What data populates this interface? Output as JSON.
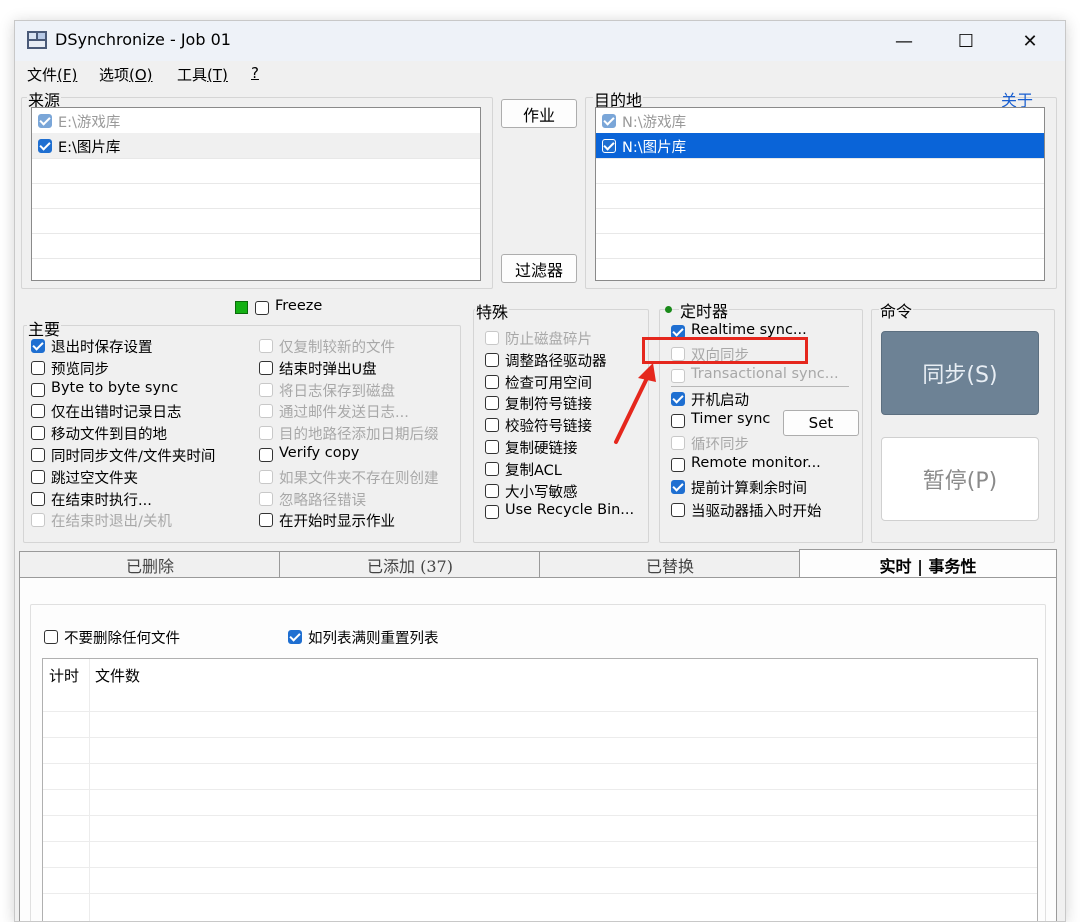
{
  "window": {
    "title": "DSynchronize - Job 01",
    "minimize": "—",
    "maximize": "☐",
    "close": "✕"
  },
  "menu": [
    {
      "label": "文件",
      "key": "(F)"
    },
    {
      "label": "选项",
      "key": "(O)"
    },
    {
      "label": "工具",
      "key": "(T)"
    },
    {
      "label": "",
      "key": "?"
    }
  ],
  "source": {
    "label": "来源",
    "items": [
      {
        "path": "E:\\游戏库",
        "checked": true
      },
      {
        "path": "E:\\图片库",
        "checked": true
      }
    ]
  },
  "destination": {
    "label": "目的地",
    "about_link": "关于",
    "items": [
      {
        "path": "N:\\游戏库",
        "checked": true
      },
      {
        "path": "N:\\图片库",
        "checked": true,
        "selected": true
      }
    ]
  },
  "buttons": {
    "job": "作业",
    "filter": "过滤器",
    "set": "Set",
    "sync": "同步(S)",
    "pause": "暂停(P)"
  },
  "main": {
    "label": "主要",
    "freeze": "Freeze",
    "col1": [
      {
        "label": "退出时保存设置",
        "checked": true,
        "enabled": true
      },
      {
        "label": "预览同步",
        "checked": false,
        "enabled": true
      },
      {
        "label": "Byte to byte sync",
        "checked": false,
        "enabled": true
      },
      {
        "label": "仅在出错时记录日志",
        "checked": false,
        "enabled": true
      },
      {
        "label": "移动文件到目的地",
        "checked": false,
        "enabled": true
      },
      {
        "label": "同时同步文件/文件夹时间",
        "checked": false,
        "enabled": true
      },
      {
        "label": "跳过空文件夹",
        "checked": false,
        "enabled": true
      },
      {
        "label": "在结束时执行...",
        "checked": false,
        "enabled": true
      },
      {
        "label": "在结束时退出/关机",
        "checked": false,
        "enabled": false
      }
    ],
    "col2": [
      {
        "label": "仅复制较新的文件",
        "checked": false,
        "enabled": false
      },
      {
        "label": "结束时弹出U盘",
        "checked": false,
        "enabled": true
      },
      {
        "label": "将日志保存到磁盘",
        "checked": false,
        "enabled": false
      },
      {
        "label": "通过邮件发送日志...",
        "checked": false,
        "enabled": false
      },
      {
        "label": "目的地路径添加日期后缀",
        "checked": false,
        "enabled": false
      },
      {
        "label": "Verify copy",
        "checked": false,
        "enabled": true
      },
      {
        "label": "如果文件夹不存在则创建",
        "checked": false,
        "enabled": false
      },
      {
        "label": "忽略路径错误",
        "checked": false,
        "enabled": false
      },
      {
        "label": "在开始时显示作业",
        "checked": false,
        "enabled": true
      }
    ]
  },
  "special": {
    "label": "特殊",
    "items": [
      {
        "label": "防止磁盘碎片",
        "checked": false,
        "enabled": false
      },
      {
        "label": "调整路径驱动器",
        "checked": false,
        "enabled": true
      },
      {
        "label": "检查可用空间",
        "checked": false,
        "enabled": true
      },
      {
        "label": "复制符号链接",
        "checked": false,
        "enabled": true
      },
      {
        "label": "校验符号链接",
        "checked": false,
        "enabled": true
      },
      {
        "label": "复制硬链接",
        "checked": false,
        "enabled": true
      },
      {
        "label": "复制ACL",
        "checked": false,
        "enabled": true
      },
      {
        "label": "大小写敏感",
        "checked": false,
        "enabled": true
      },
      {
        "label": "Use Recycle Bin...",
        "checked": false,
        "enabled": true
      }
    ]
  },
  "timer": {
    "label": "定时器",
    "indicator_color": "#1a8a1a",
    "items": [
      {
        "label": "Realtime sync...",
        "checked": true,
        "enabled": true
      },
      {
        "label": "双向同步",
        "checked": false,
        "enabled": false
      },
      {
        "label": "Transactional sync...",
        "checked": false,
        "enabled": false
      },
      {
        "label": "开机启动",
        "checked": true,
        "enabled": true
      },
      {
        "label": "Timer sync",
        "checked": false,
        "enabled": true
      },
      {
        "label": "循环同步",
        "checked": false,
        "enabled": false
      },
      {
        "label": "Remote monitor...",
        "checked": false,
        "enabled": true
      },
      {
        "label": "提前计算剩余时间",
        "checked": true,
        "enabled": true
      },
      {
        "label": "当驱动器插入时开始",
        "checked": false,
        "enabled": true
      }
    ]
  },
  "command": {
    "label": "命令"
  },
  "tabs": [
    "已删除",
    "已添加 (37)",
    "已替换",
    "实时 | 事务性"
  ],
  "realtime": {
    "no_delete": {
      "label": "不要删除任何文件",
      "checked": false
    },
    "reset_list": {
      "label": "如列表满则重置列表",
      "checked": true
    },
    "columns": [
      "计时",
      "文件数"
    ]
  },
  "colors": {
    "accent": "#1f6fd1",
    "selection": "#0a64d8",
    "sync_button": "#6d8295",
    "annotation": "#e5271d",
    "freeze_indicator": "#14b014"
  }
}
